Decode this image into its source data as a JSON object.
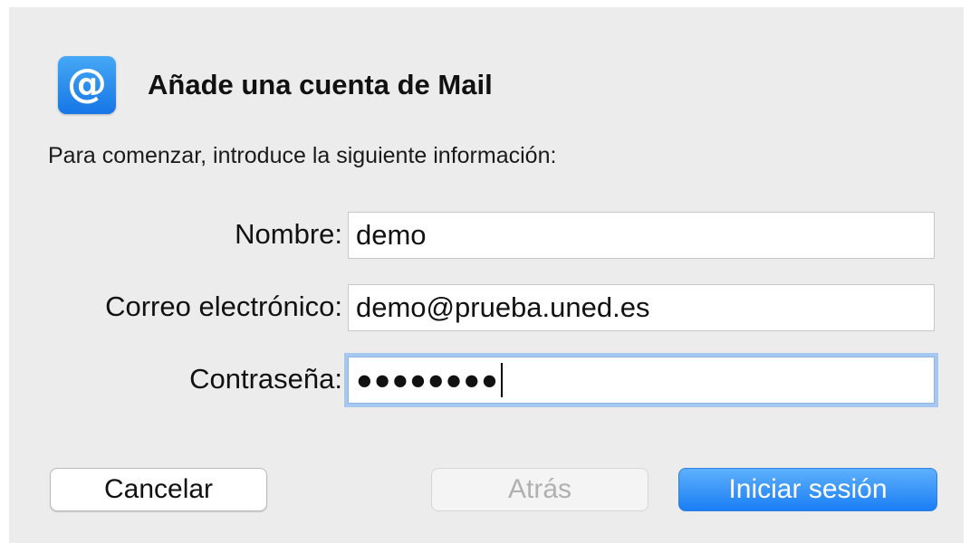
{
  "dialog": {
    "app_icon_glyph": "@",
    "title": "Añade una cuenta de Mail",
    "intro": "Para comenzar, introduce la siguiente información:"
  },
  "form": {
    "name_label": "Nombre:",
    "name_value": "demo",
    "email_label": "Correo electrónico:",
    "email_value": "demo@prueba.uned.es",
    "password_label": "Contraseña:",
    "password_masked": "●●●●●●●●"
  },
  "buttons": {
    "cancel": "Cancelar",
    "back": "Atrás",
    "sign_in": "Iniciar sesión"
  },
  "colors": {
    "dialog_bg": "#ececec",
    "accent": "#1a7ef5",
    "focus_ring": "#a6c8f0"
  },
  "icons": {
    "app": "mail-at-icon"
  }
}
